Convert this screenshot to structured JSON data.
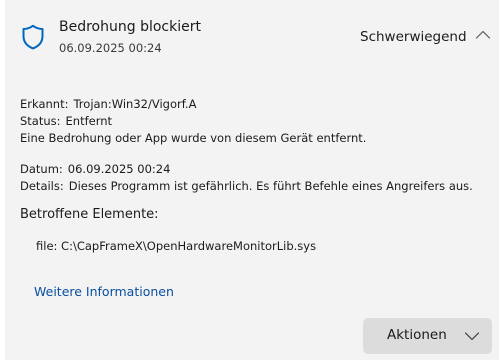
{
  "header": {
    "title": "Bedrohung blockiert",
    "timestamp": "06.09.2025 00:24",
    "severity": "Schwerwiegend",
    "icon": "shield-icon",
    "expand_icon": "chevron-up-icon"
  },
  "details": {
    "detected_label": "Erkannt:",
    "detected_value": "Trojan:Win32/Vigorf.A",
    "status_label": "Status:",
    "status_value": "Entfernt",
    "status_message": "Eine Bedrohung oder App wurde von diesem Gerät entfernt.",
    "date_label": "Datum:",
    "date_value": "06.09.2025 00:24",
    "details_label": "Details:",
    "details_value": "Dieses Programm ist gefährlich. Es führt Befehle eines Angreifers aus."
  },
  "affected": {
    "title": "Betroffene Elemente:",
    "items": [
      {
        "prefix": "file:",
        "path": "C:\\CapFrameX\\OpenHardwareMonitorLib.sys"
      }
    ]
  },
  "links": {
    "more_info": "Weitere Informationen"
  },
  "actions": {
    "label": "Aktionen",
    "icon": "chevron-down-icon"
  },
  "colors": {
    "card_background": "#f3f3f3",
    "shield_accent": "#0067c0",
    "link": "#0a4fa0",
    "button_background": "#dcdcdc"
  }
}
